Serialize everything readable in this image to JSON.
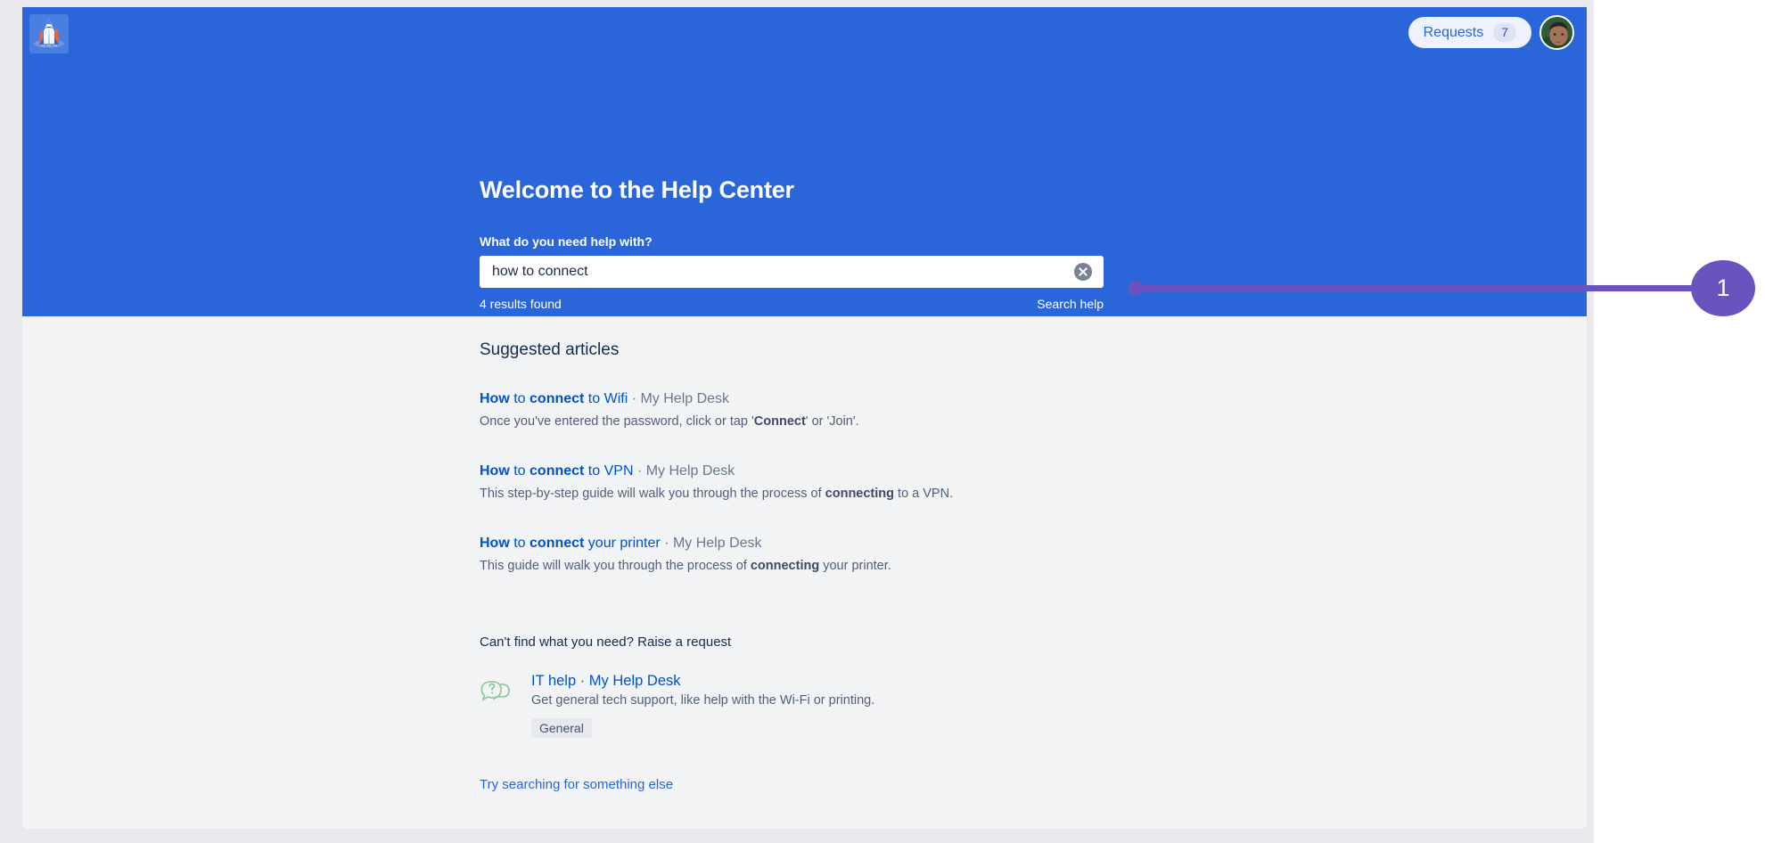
{
  "header": {
    "logo_icon": "rocket-icon",
    "requests_label": "Requests",
    "requests_count": "7",
    "avatar_icon": "user-avatar"
  },
  "hero": {
    "title": "Welcome to the Help Center",
    "search_label": "What do you need help with?",
    "search_value": "how to connect",
    "search_placeholder": "What do you need help with?",
    "clear_icon": "clear-circle-icon",
    "results_found": "4 results found",
    "search_help_label": "Search help",
    "background_color": "#2a66d9"
  },
  "results": {
    "section_title": "Suggested articles",
    "articles": [
      {
        "title_parts": [
          {
            "text": "How",
            "bold": true
          },
          {
            "text": " to ",
            "bold": false
          },
          {
            "text": "connect",
            "bold": true
          },
          {
            "text": " to Wifi",
            "bold": false
          }
        ],
        "title_plain": "How to connect to Wifi",
        "separator": " · ",
        "source": "My Help Desk",
        "description_parts": [
          {
            "text": "Once you've entered the password, click or tap '",
            "bold": false
          },
          {
            "text": "Connect",
            "bold": true
          },
          {
            "text": "' or 'Join'.",
            "bold": false
          }
        ],
        "description_plain": "Once you've entered the password, click or tap 'Connect' or 'Join'."
      },
      {
        "title_parts": [
          {
            "text": "How",
            "bold": true
          },
          {
            "text": " to ",
            "bold": false
          },
          {
            "text": "connect",
            "bold": true
          },
          {
            "text": " to VPN",
            "bold": false
          }
        ],
        "title_plain": "How to connect to VPN",
        "separator": " · ",
        "source": "My Help Desk",
        "description_parts": [
          {
            "text": "This step-by-step guide will walk you through the process of ",
            "bold": false
          },
          {
            "text": "connecting",
            "bold": true
          },
          {
            "text": " to a VPN.",
            "bold": false
          }
        ],
        "description_plain": "This step-by-step guide will walk you through the process of connecting to a VPN."
      },
      {
        "title_parts": [
          {
            "text": "How",
            "bold": true
          },
          {
            "text": " to ",
            "bold": false
          },
          {
            "text": "connect",
            "bold": true
          },
          {
            "text": " your printer",
            "bold": false
          }
        ],
        "title_plain": "How to connect your printer",
        "separator": " · ",
        "source": "My Help Desk",
        "description_parts": [
          {
            "text": "This guide will walk you through the process of ",
            "bold": false
          },
          {
            "text": "connecting",
            "bold": true
          },
          {
            "text": " your printer.",
            "bold": false
          }
        ],
        "description_plain": "This guide will walk you through the process of connecting your printer."
      }
    ],
    "raise_request_heading": "Can't find what you need? Raise a request",
    "request": {
      "icon": "speech-bubbles-question-icon",
      "link_label": "IT help · My Help Desk",
      "description": "Get general tech support, like help with the Wi-Fi or printing.",
      "tag": "General"
    },
    "try_again_label": "Try searching for something else"
  },
  "annotation": {
    "number": "1",
    "color": "#6a53be"
  }
}
